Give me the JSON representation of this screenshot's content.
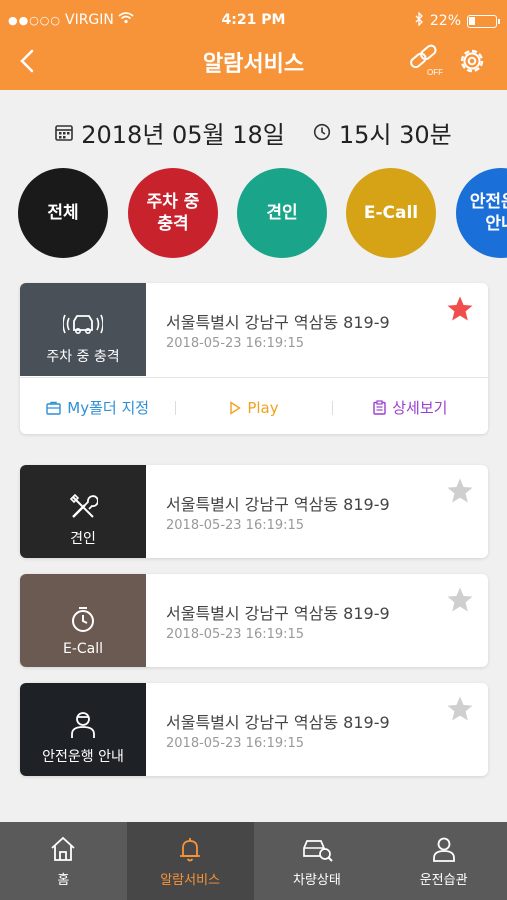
{
  "status_bar": {
    "carrier": "VIRGIN",
    "time": "4:21 PM",
    "battery": "22%"
  },
  "header": {
    "title": "알람서비스",
    "link_badge": "OFF"
  },
  "date_bar": {
    "date": "2018년 05월 18일",
    "time": "15시 30분"
  },
  "categories": [
    {
      "label": "전체",
      "color": "#1a1a1a"
    },
    {
      "label": "주차 중\n충격",
      "color": "#c8232c"
    },
    {
      "label": "견인",
      "color": "#1aa58a"
    },
    {
      "label": "E-Call",
      "color": "#d6a216"
    },
    {
      "label": "안전운행\n안내",
      "color": "#1b6fd9"
    }
  ],
  "alerts": [
    {
      "type_label": "주차 중 충격",
      "icon": "car-signal-icon",
      "address": "서울특별시 강남구 역삼동 819-9",
      "timestamp": "2018-05-23 16:19:15",
      "starred": true,
      "thumb_color": "#4a5058"
    },
    {
      "type_label": "견인",
      "icon": "tools-icon",
      "address": "서울특별시 강남구 역삼동 819-9",
      "timestamp": "2018-05-23 16:19:15",
      "starred": false,
      "thumb_color": "#262626"
    },
    {
      "type_label": "E-Call",
      "icon": "phone-clock-icon",
      "address": "서울특별시 강남구 역삼동 819-9",
      "timestamp": "2018-05-23 16:19:15",
      "starred": false,
      "thumb_color": "#6b5a52"
    },
    {
      "type_label": "안전운행 안내",
      "icon": "driver-icon",
      "address": "서울특별시 강남구 역삼동 819-9",
      "timestamp": "2018-05-23 16:19:15",
      "starred": false,
      "thumb_color": "#1e2126"
    }
  ],
  "expanded_actions": {
    "myfolder": {
      "label": "My폴더 지정",
      "color": "#2d8fd6"
    },
    "play": {
      "label": "Play",
      "color": "#f0a31f"
    },
    "detail": {
      "label": "상세보기",
      "color": "#9b3fcf"
    }
  },
  "tabs": [
    {
      "label": "홈",
      "icon": "home-icon"
    },
    {
      "label": "알람서비스",
      "icon": "bell-icon",
      "active": true
    },
    {
      "label": "차량상태",
      "icon": "car-search-icon"
    },
    {
      "label": "운전습관",
      "icon": "user-icon"
    }
  ],
  "colors": {
    "brand": "#f7943a",
    "star_active": "#f24d4d",
    "star_inactive": "#cfcfcf"
  }
}
